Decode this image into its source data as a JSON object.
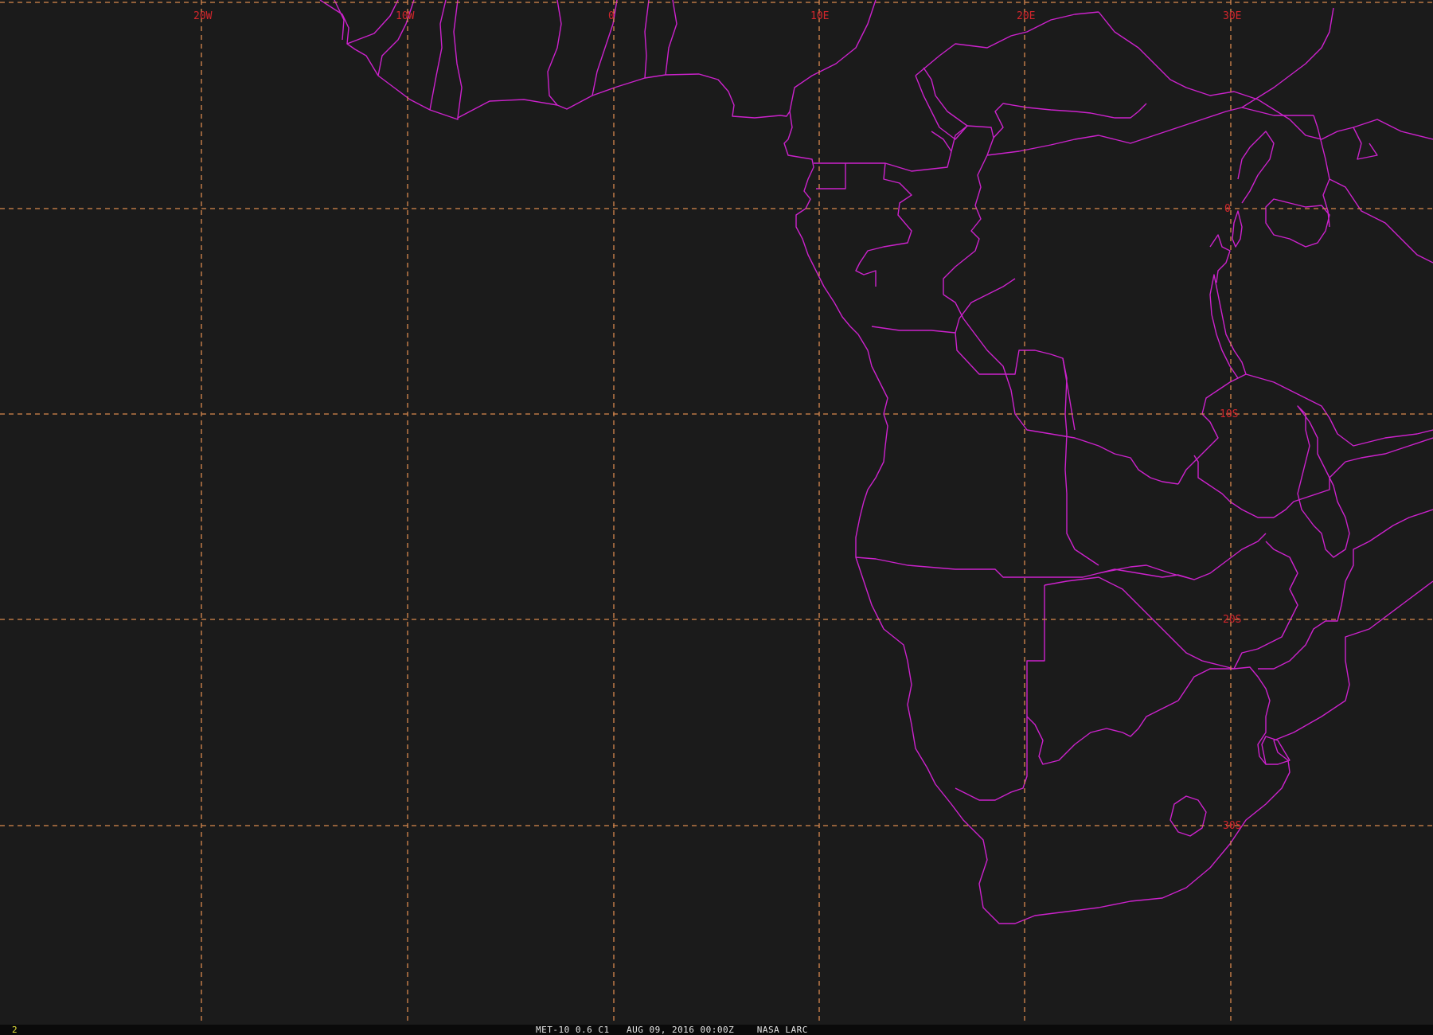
{
  "map": {
    "background_color": "#1b1b1b",
    "grid_color": "#d9894e",
    "label_color": "#d3262c",
    "border_color": "#cc22cc",
    "longitude_labels": [
      "20W",
      "10W",
      "0",
      "10E",
      "20E",
      "30E"
    ],
    "latitude_labels": [
      "0",
      "10S",
      "20S",
      "30S"
    ]
  },
  "status": {
    "frame_number": "2",
    "caption": "MET-10 0.6 C1   AUG 09, 2016 00:00Z    NASA LARC"
  }
}
